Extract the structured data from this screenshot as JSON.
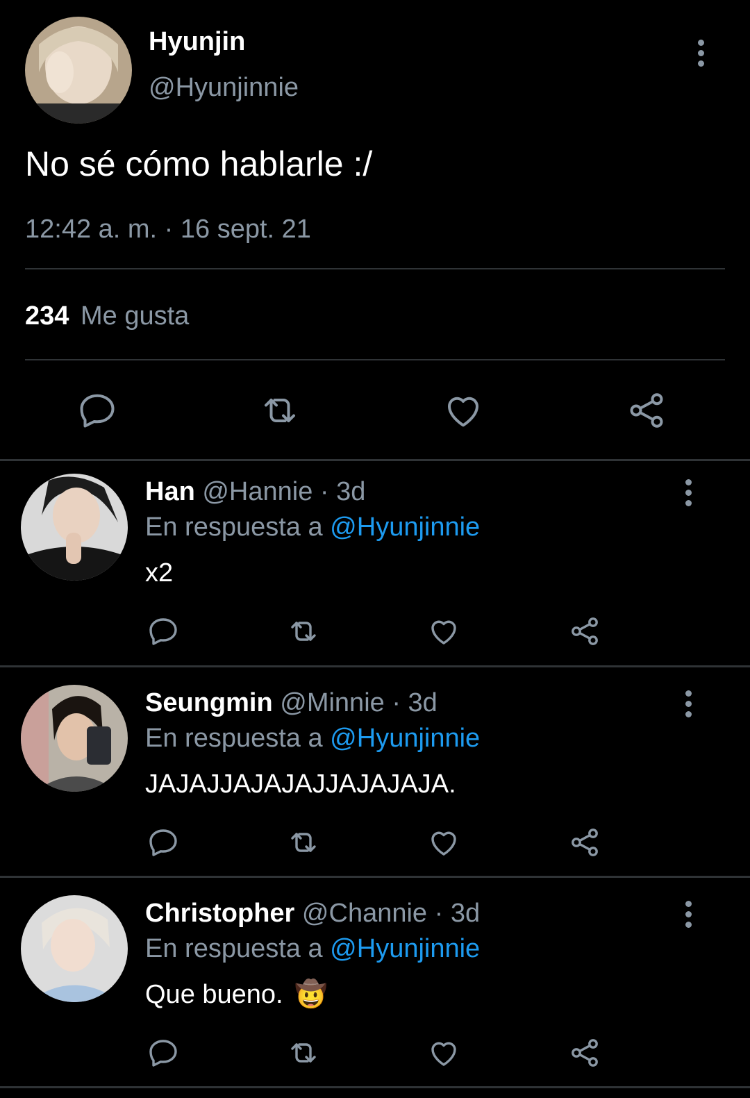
{
  "tweet": {
    "author_name": "Hyunjin",
    "author_handle": "@Hyunjinnie",
    "text": "No sé cómo hablarle :/",
    "timestamp": "12:42 a. m. · 16 sept. 21",
    "likes_count": "234",
    "likes_label": "Me gusta"
  },
  "replies": [
    {
      "name": "Han",
      "handle": "@Hannie",
      "time": "· 3d",
      "reply_prefix": "En respuesta a",
      "reply_to": "@Hyunjinnie",
      "text": "x2"
    },
    {
      "name": "Seungmin",
      "handle": "@Minnie",
      "time": "· 3d",
      "reply_prefix": "En respuesta a",
      "reply_to": "@Hyunjinnie",
      "text": "JAJAJJAJAJAJJAJAJAJA."
    },
    {
      "name": "Christopher",
      "handle": "@Channie",
      "time": "· 3d",
      "reply_prefix": "En respuesta a",
      "reply_to": "@Hyunjinnie",
      "text": "Que bueno.",
      "emoji": "🤠"
    }
  ],
  "icons": {
    "reply": "reply-icon",
    "retweet": "retweet-icon",
    "like": "heart-icon",
    "share": "share-icon",
    "more": "more-vertical-icon"
  },
  "colors": {
    "background": "#000000",
    "text": "#e7e9ea",
    "muted": "#8b98a5",
    "link": "#1d9bf0",
    "divider": "#2f3336"
  }
}
